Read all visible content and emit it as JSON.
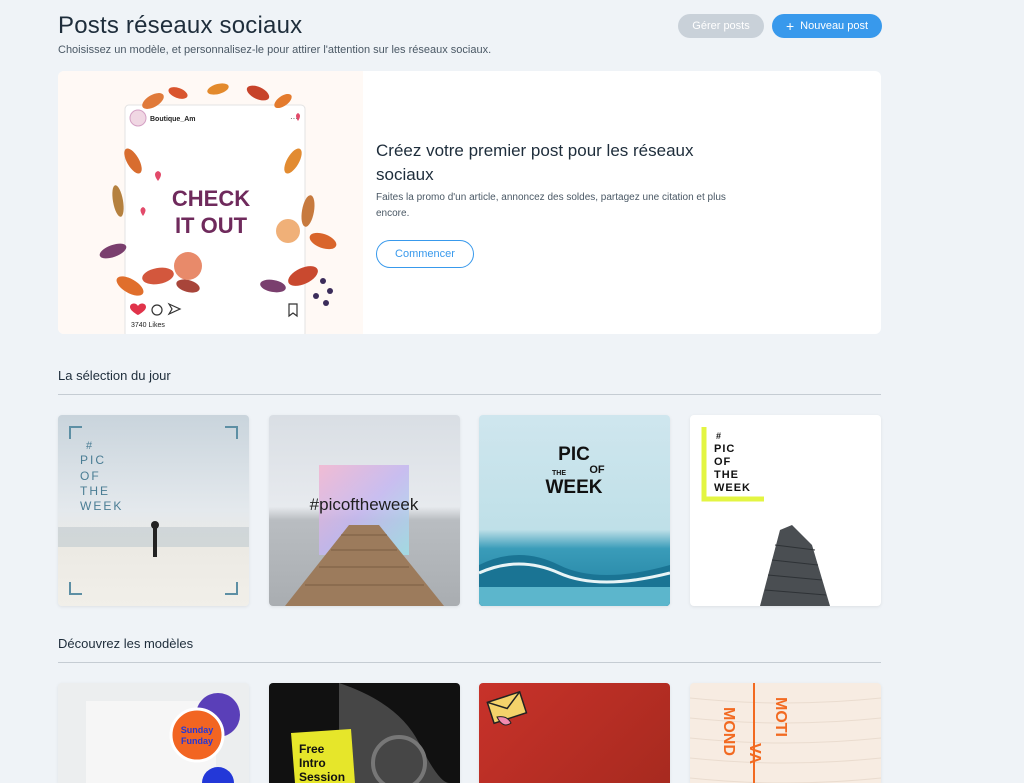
{
  "header": {
    "title": "Posts réseaux sociaux",
    "subtitle": "Choisissez un modèle, et personnalisez-le pour attirer l'attention sur les réseaux sociaux.",
    "manage_label": "Gérer posts",
    "new_label": "Nouveau post"
  },
  "hero": {
    "mock_username": "Boutique_Am",
    "mock_text_line1": "CHECK",
    "mock_text_line2": "IT OUT",
    "mock_likes": "3740 Likes",
    "title": "Créez votre premier post pour les réseaux sociaux",
    "description": "Faites la promo d'un article, annoncez des soldes, partagez une citation et plus encore.",
    "start_label": "Commencer"
  },
  "daily": {
    "title": "La sélection du jour",
    "cards": [
      {
        "lines": [
          "#",
          "PIC",
          "OF",
          "THE",
          "WEEK"
        ]
      },
      {
        "text": "#picoftheweek"
      },
      {
        "lines": [
          "PIC",
          "OF",
          "THE",
          "WEEK"
        ]
      },
      {
        "lines": [
          "#",
          "PIC",
          "OF",
          "THE",
          "WEEK"
        ]
      }
    ]
  },
  "templates": {
    "title": "Découvrez les modèles",
    "cards": [
      {
        "sticker_line1": "Sunday",
        "sticker_line2": "Funday"
      },
      {
        "line1": "Free",
        "line2": "Intro",
        "line3": "Session"
      },
      {},
      {
        "word1": "MOTI",
        "word2": "VA",
        "word3": "MOND"
      }
    ]
  },
  "colors": {
    "accent": "#3899ec",
    "disabled": "#c9d1d9",
    "background": "#eff3f7"
  }
}
